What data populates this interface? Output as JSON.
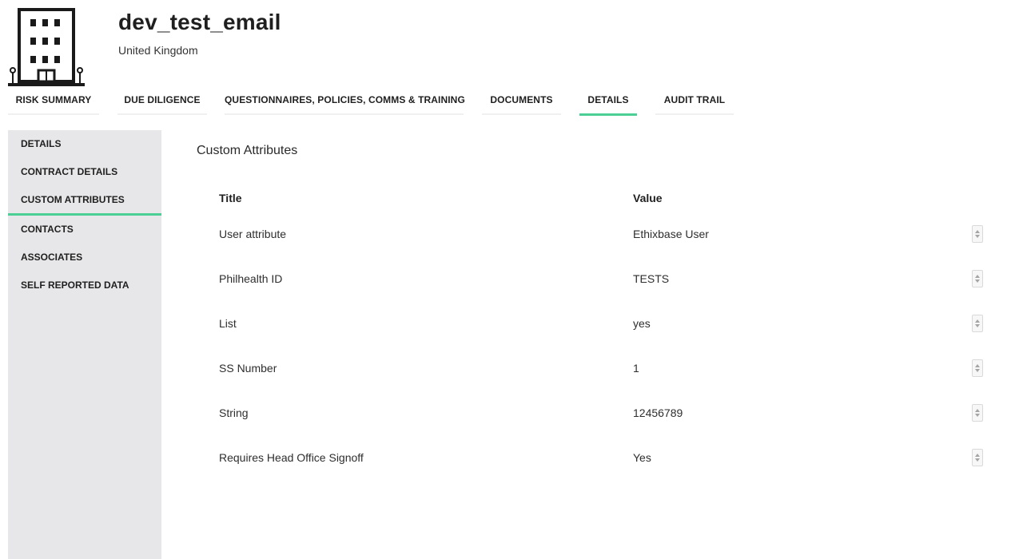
{
  "header": {
    "title": "dev_test_email",
    "country": "United Kingdom",
    "logo_icon": "building-icon"
  },
  "tabs": [
    {
      "label": "RISK SUMMARY",
      "active": false
    },
    {
      "label": "DUE DILIGENCE",
      "active": false
    },
    {
      "label": "QUESTIONNAIRES, POLICIES, COMMS & TRAINING",
      "active": false
    },
    {
      "label": "DOCUMENTS",
      "active": false
    },
    {
      "label": "DETAILS",
      "active": true
    },
    {
      "label": "AUDIT TRAIL",
      "active": false
    }
  ],
  "sidebar": {
    "items": [
      {
        "label": "DETAILS",
        "active": false
      },
      {
        "label": "CONTRACT DETAILS",
        "active": false
      },
      {
        "label": "CUSTOM ATTRIBUTES",
        "active": true
      },
      {
        "label": "CONTACTS",
        "active": false
      },
      {
        "label": "ASSOCIATES",
        "active": false
      },
      {
        "label": "SELF REPORTED DATA",
        "active": false
      }
    ]
  },
  "main": {
    "section_title": "Custom Attributes",
    "table": {
      "headers": {
        "title": "Title",
        "value": "Value"
      },
      "rows": [
        {
          "title": "User attribute",
          "value": "Ethixbase User"
        },
        {
          "title": "Philhealth ID",
          "value": "TESTS"
        },
        {
          "title": "List",
          "value": "yes"
        },
        {
          "title": "SS Number",
          "value": "1"
        },
        {
          "title": "String",
          "value": "12456789"
        },
        {
          "title": "Requires Head Office Signoff",
          "value": "Yes"
        }
      ]
    }
  },
  "colors": {
    "accent": "#4ccf94",
    "sidebar_bg": "#e7e7e9",
    "text": "#1f1f1f"
  }
}
